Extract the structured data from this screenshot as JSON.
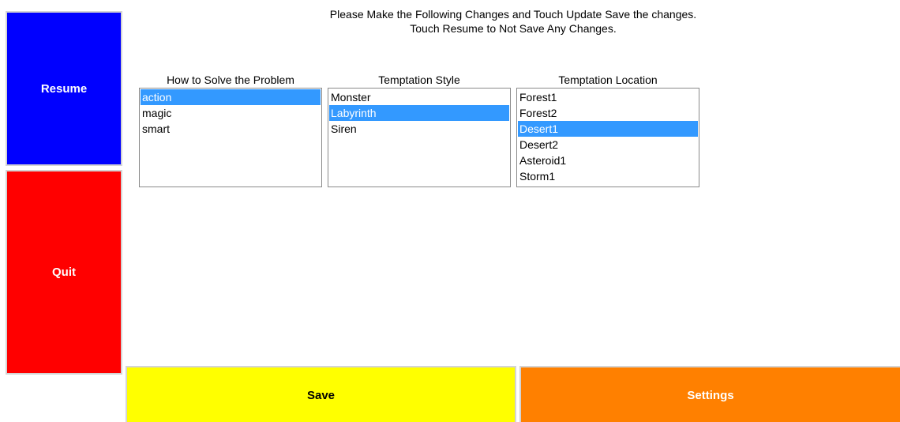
{
  "instructions": {
    "line1": "Please Make the Following Changes and Touch Update Save the changes.",
    "line2": "Touch Resume to Not Save Any Changes."
  },
  "buttons": {
    "resume": {
      "label": "Resume",
      "color": "#0000ff"
    },
    "quit": {
      "label": "Quit",
      "color": "#ff0000"
    },
    "save": {
      "label": "Save",
      "color": "#ffff00"
    },
    "settings": {
      "label": "Settings",
      "color": "#ff8000"
    }
  },
  "selection_color": "#3399ff",
  "lists": [
    {
      "label": "How to Solve the Problem",
      "options": [
        "action",
        "magic",
        "smart"
      ],
      "selected": "action"
    },
    {
      "label": "Temptation Style",
      "options": [
        "Monster",
        "Labyrinth",
        "Siren"
      ],
      "selected": "Labyrinth"
    },
    {
      "label": "Temptation Location",
      "options": [
        "Forest1",
        "Forest2",
        "Desert1",
        "Desert2",
        "Asteroid1",
        "Storm1"
      ],
      "selected": "Desert1"
    }
  ]
}
